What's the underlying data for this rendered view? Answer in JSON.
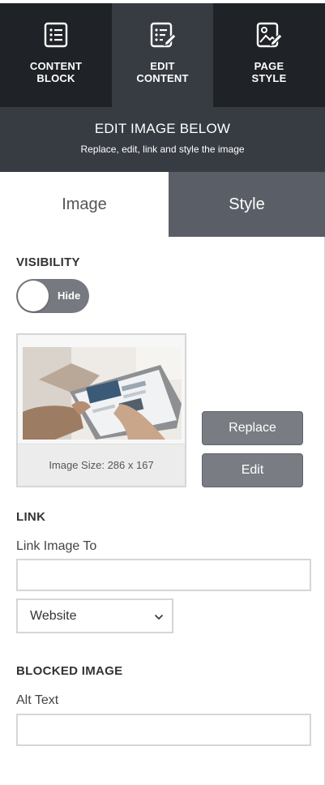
{
  "topnav": {
    "items": [
      {
        "label": "CONTENT\nBLOCK",
        "icon": "list-box-icon",
        "active": false
      },
      {
        "label": "EDIT\nCONTENT",
        "icon": "edit-list-icon",
        "active": true
      },
      {
        "label": "PAGE\nSTYLE",
        "icon": "image-edit-icon",
        "active": false
      }
    ]
  },
  "header": {
    "title": "EDIT IMAGE BELOW",
    "subtitle": "Replace, edit, link and style the image"
  },
  "tabs": {
    "image": "Image",
    "style": "Style"
  },
  "visibility": {
    "title": "VISIBILITY",
    "toggle_label": "Hide"
  },
  "image": {
    "caption": "Image Size: 286 x 167",
    "replace_label": "Replace",
    "edit_label": "Edit"
  },
  "link": {
    "title": "LINK",
    "field_label": "Link Image To",
    "value": "",
    "select_value": "Website"
  },
  "blocked": {
    "title": "BLOCKED IMAGE",
    "field_label": "Alt Text",
    "value": ""
  },
  "colors": {
    "nav_bg": "#1f2226",
    "nav_active": "#373b42",
    "style_tab": "#5a5f67",
    "button": "#797c82"
  }
}
